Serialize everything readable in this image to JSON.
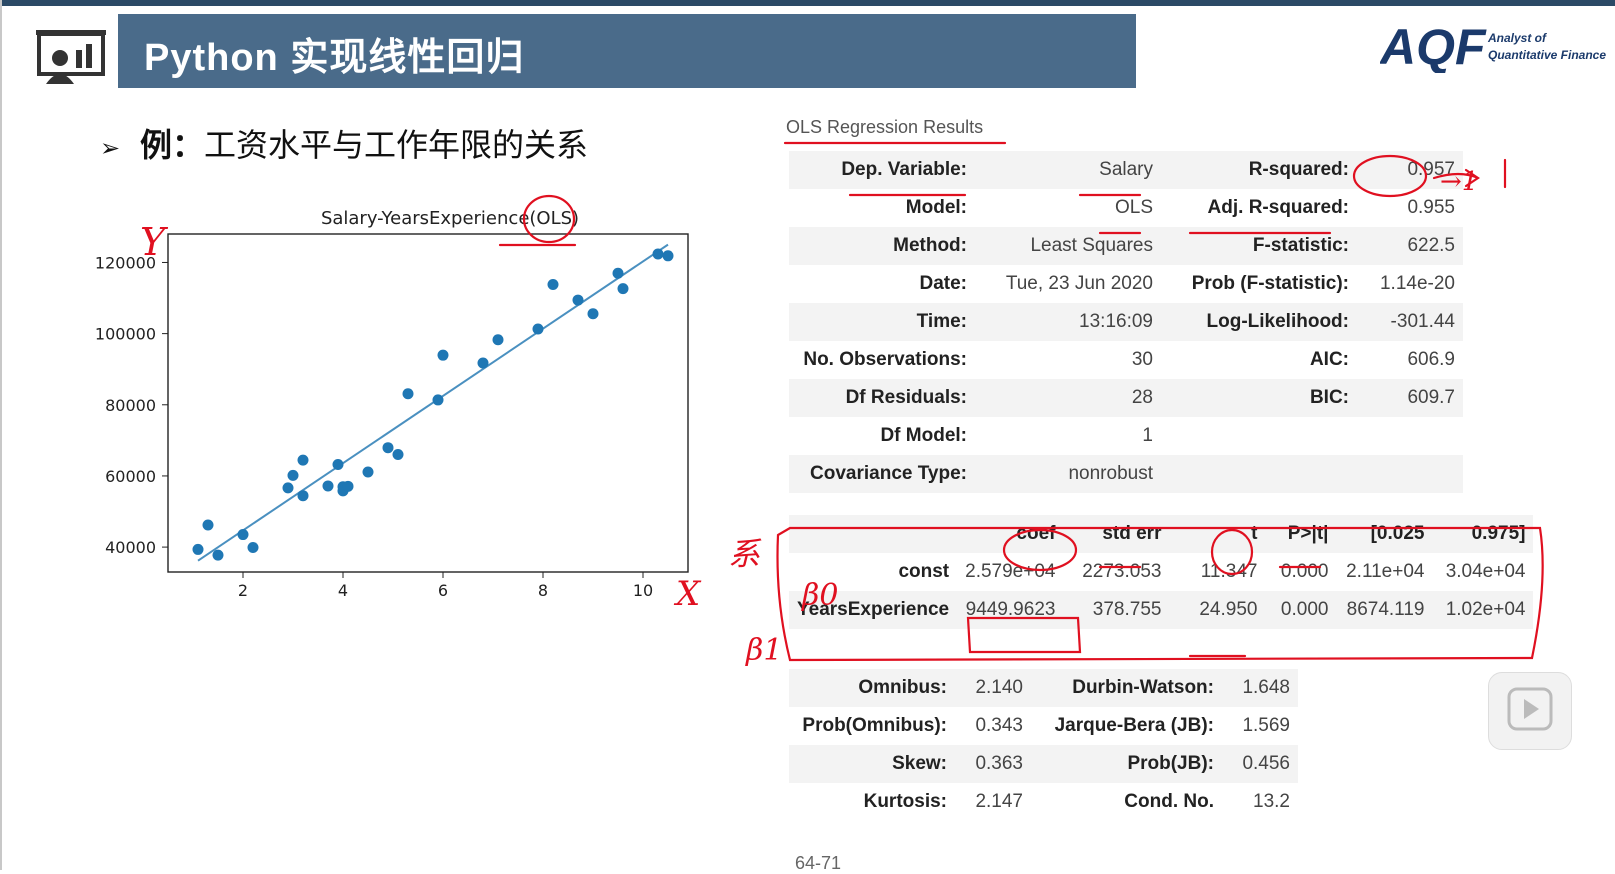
{
  "header": {
    "title": "Python 实现线性回归",
    "brand_logo": "AQF",
    "brand_line1": "Analyst of",
    "brand_line2": "Quantitative Finance",
    "logo_icon": "presentation-chart-icon"
  },
  "bullet": {
    "marker": "➢",
    "bold": "例：",
    "text": "工资水平与工作年限的关系"
  },
  "chart_data": {
    "type": "scatter",
    "title": "Salary-YearsExperience(OLS)",
    "xlabel": "",
    "ylabel": "",
    "xlim": [
      0.5,
      10.9
    ],
    "ylim": [
      33000,
      128000
    ],
    "xticks": [
      2,
      4,
      6,
      8,
      10
    ],
    "yticks": [
      40000,
      60000,
      80000,
      100000,
      120000
    ],
    "points": [
      [
        1.1,
        39343
      ],
      [
        1.3,
        46205
      ],
      [
        1.5,
        37731
      ],
      [
        2.0,
        43525
      ],
      [
        2.2,
        39891
      ],
      [
        2.9,
        56642
      ],
      [
        3.0,
        60150
      ],
      [
        3.2,
        54445
      ],
      [
        3.2,
        64445
      ],
      [
        3.7,
        57189
      ],
      [
        3.9,
        63218
      ],
      [
        4.0,
        55794
      ],
      [
        4.0,
        56957
      ],
      [
        4.1,
        57081
      ],
      [
        4.5,
        61111
      ],
      [
        4.9,
        67938
      ],
      [
        5.1,
        66029
      ],
      [
        5.3,
        83088
      ],
      [
        5.9,
        81363
      ],
      [
        6.0,
        93940
      ],
      [
        6.8,
        91738
      ],
      [
        7.1,
        98273
      ],
      [
        7.9,
        101302
      ],
      [
        8.2,
        113812
      ],
      [
        8.7,
        109431
      ],
      [
        9.0,
        105582
      ],
      [
        9.5,
        116969
      ],
      [
        9.6,
        112635
      ],
      [
        10.3,
        122391
      ],
      [
        10.5,
        121872
      ]
    ],
    "fit_line": {
      "intercept": 25790,
      "slope": 9449.9623,
      "x_range": [
        1.1,
        10.5
      ]
    },
    "colors": {
      "points": "#1f77b4",
      "line": "#4a90c0"
    },
    "grid": false
  },
  "ols": {
    "title": "OLS Regression Results",
    "rows": [
      [
        "Dep. Variable:",
        "Salary",
        "R-squared:",
        "0.957"
      ],
      [
        "Model:",
        "OLS",
        "Adj. R-squared:",
        "0.955"
      ],
      [
        "Method:",
        "Least Squares",
        "F-statistic:",
        "622.5"
      ],
      [
        "Date:",
        "Tue, 23 Jun 2020",
        "Prob (F-statistic):",
        "1.14e-20"
      ],
      [
        "Time:",
        "13:16:09",
        "Log-Likelihood:",
        "-301.44"
      ],
      [
        "No. Observations:",
        "30",
        "AIC:",
        "606.9"
      ],
      [
        "Df Residuals:",
        "28",
        "BIC:",
        "609.7"
      ],
      [
        "Df Model:",
        "1",
        "",
        ""
      ],
      [
        "Covariance Type:",
        "nonrobust",
        "",
        ""
      ]
    ],
    "coef_header": [
      "",
      "coef",
      "std err",
      "t",
      "P>|t|",
      "[0.025",
      "0.975]"
    ],
    "coef_rows": [
      [
        "const",
        "2.579e+04",
        "2273.053",
        "11.347",
        "0.000",
        "2.11e+04",
        "3.04e+04"
      ],
      [
        "YearsExperience",
        "9449.9623",
        "378.755",
        "24.950",
        "0.000",
        "8674.119",
        "1.02e+04"
      ]
    ],
    "diag_rows": [
      [
        "Omnibus:",
        "2.140",
        "Durbin-Watson:",
        "1.648"
      ],
      [
        "Prob(Omnibus):",
        "0.343",
        "Jarque-Bera (JB):",
        "1.569"
      ],
      [
        "Skew:",
        "0.363",
        "Prob(JB):",
        "0.456"
      ],
      [
        "Kurtosis:",
        "2.147",
        "Cond. No.",
        "13.2"
      ]
    ]
  },
  "annotations": {
    "y_axis": "Y",
    "x_axis": "X",
    "r2_note": "→1",
    "coef_note": "系",
    "beta0": "β0",
    "beta1": "β1"
  },
  "page_number": "64-71",
  "player": {
    "icon": "play-icon"
  }
}
